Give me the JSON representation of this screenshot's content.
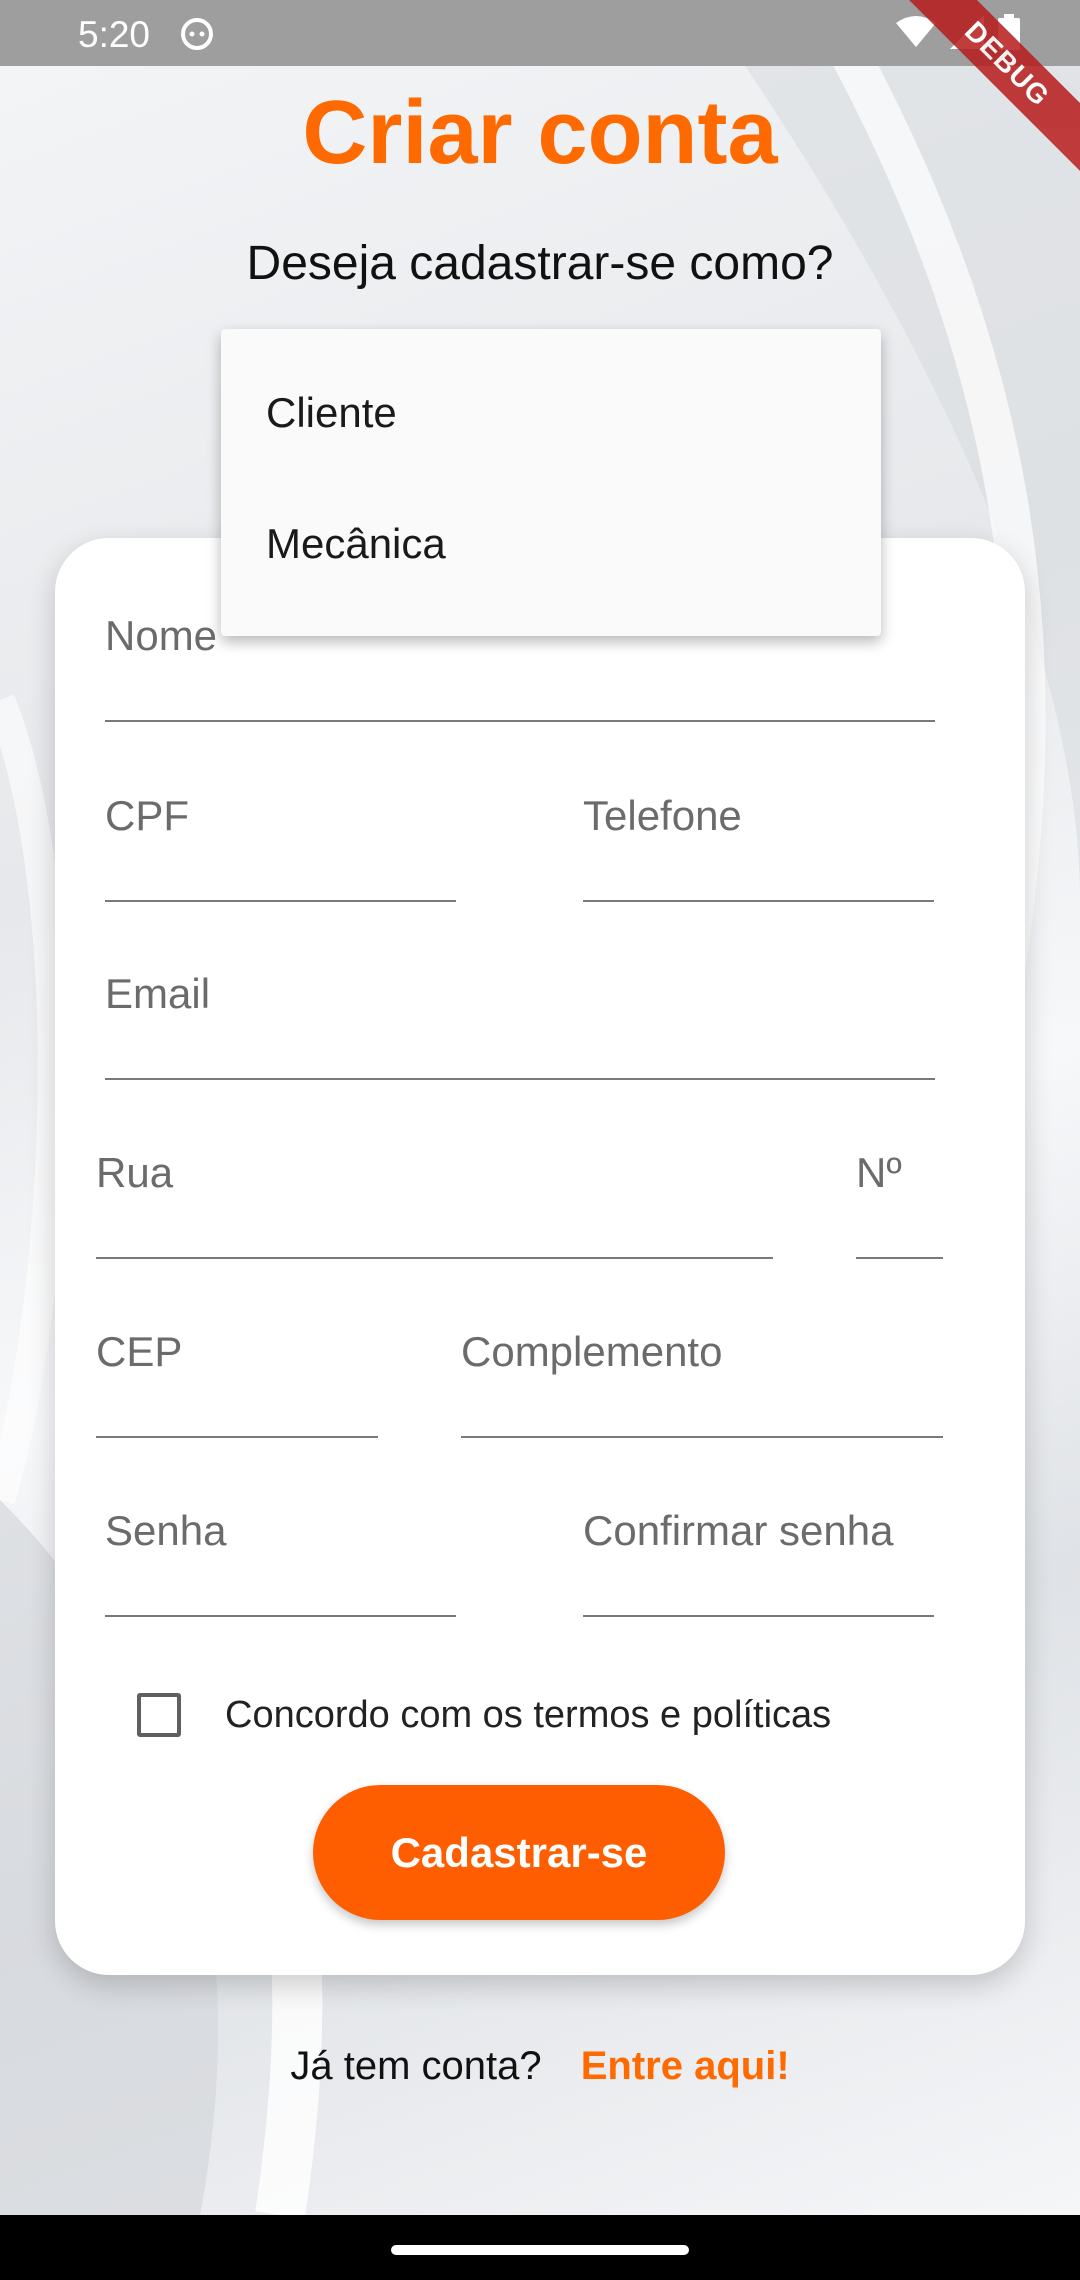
{
  "status_bar": {
    "time": "5:20",
    "robot_icon": "android-robot-icon",
    "wifi_icon": "wifi-icon",
    "signal_icon": "cell-signal-icon",
    "battery_icon": "battery-icon"
  },
  "debug_banner": "DEBUG",
  "header": {
    "title": "Criar conta",
    "subtitle": "Deseja cadastrar-se como?"
  },
  "dropdown": {
    "options": [
      "Cliente",
      "Mecânica"
    ]
  },
  "form": {
    "fields": {
      "nome": "Nome",
      "cpf": "CPF",
      "telefone": "Telefone",
      "email": "Email",
      "rua": "Rua",
      "numero": "Nº",
      "cep": "CEP",
      "complemento": "Complemento",
      "senha": "Senha",
      "confirmar_senha": "Confirmar senha"
    },
    "terms_label": "Concordo com os termos e políticas",
    "terms_checked": false,
    "submit_label": "Cadastrar-se"
  },
  "footer": {
    "question": "Já tem conta?",
    "link": "Entre aqui!"
  },
  "colors": {
    "accent": "#FF6A00",
    "button": "#FF5E00"
  }
}
